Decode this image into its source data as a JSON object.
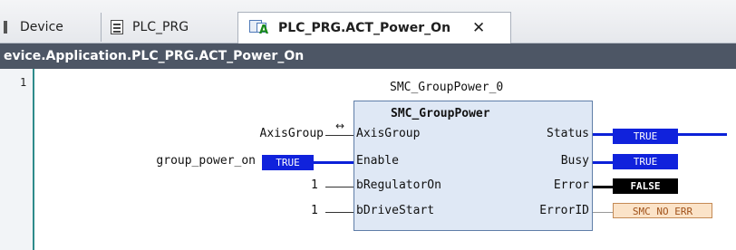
{
  "tabs": [
    {
      "label": "Device",
      "icon": "device-icon"
    },
    {
      "label": "PLC_PRG",
      "icon": "pou-icon"
    },
    {
      "label": "PLC_PRG.ACT_Power_On",
      "icon": "action-icon",
      "active": true
    }
  ],
  "close_glyph": "✕",
  "path": "evice.Application.PLC_PRG.ACT_Power_On",
  "editor": {
    "line_number": "1",
    "instance_name": "SMC_GroupPower_0",
    "fb_type": "SMC_GroupPower",
    "inputs": [
      {
        "pin": "AxisGroup",
        "arg": "AxisGroup",
        "ref_marker": "↔"
      },
      {
        "pin": "Enable",
        "arg": "group_power_on",
        "live": "TRUE"
      },
      {
        "pin": "bRegulatorOn",
        "arg": "1"
      },
      {
        "pin": "bDriveStart",
        "arg": "1"
      }
    ],
    "outputs": [
      {
        "pin": "Status",
        "live": "TRUE"
      },
      {
        "pin": "Busy",
        "live": "TRUE"
      },
      {
        "pin": "Error",
        "live": "FALSE"
      },
      {
        "pin": "ErrorID",
        "live": "SMC NO ERR"
      }
    ]
  },
  "colors": {
    "live_true": "#1022dc",
    "live_false": "#000000",
    "path_bar": "#4d5665",
    "error_id_bg": "#fbe3c8"
  }
}
